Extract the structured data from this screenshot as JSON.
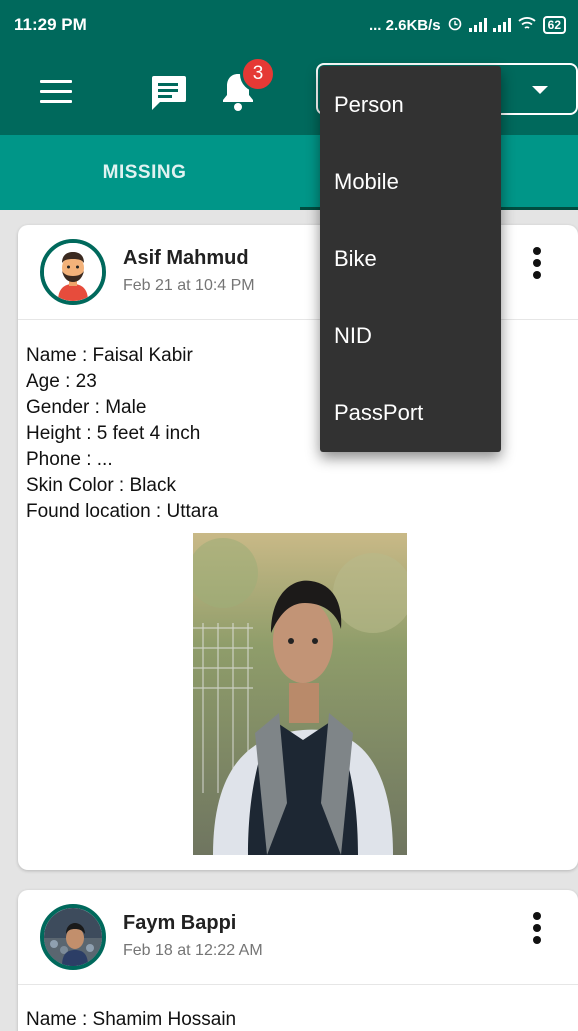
{
  "status_bar": {
    "time": "11:29 PM",
    "network_speed": "... 2.6KB/s",
    "battery": "62",
    "icons": [
      "alarm-icon",
      "signal-icon",
      "signal-icon",
      "wifi-icon",
      "battery-icon"
    ]
  },
  "toolbar": {
    "menu_icon": "hamburger-icon",
    "chat_icon": "chat-icon",
    "bell_icon": "bell-icon",
    "notification_count": "3",
    "type_select": {
      "selected": ""
    }
  },
  "colors": {
    "primary_dark": "#00695c",
    "primary": "#009688",
    "badge": "#e53935",
    "menu_bg": "#323232"
  },
  "tabs": [
    {
      "label": "MISSING",
      "selected": false
    },
    {
      "label": "",
      "selected": true
    }
  ],
  "dropdown_menu": {
    "items": [
      "Person",
      "Mobile",
      "Bike",
      "NID",
      "PassPort"
    ]
  },
  "posts": [
    {
      "author": "Asif Mahmud",
      "date": "Feb 21 at 10:4 PM",
      "details": [
        "Name : Faisal Kabir",
        "Age : 23",
        "Gender : Male",
        "Height : 5 feet 4 inch",
        "Phone : ...",
        "Skin Color : Black",
        "Found location : Uttara"
      ]
    },
    {
      "author": "Faym Bappi",
      "date": "Feb 18 at 12:22 AM",
      "details": [
        "Name : Shamim Hossain"
      ]
    }
  ]
}
